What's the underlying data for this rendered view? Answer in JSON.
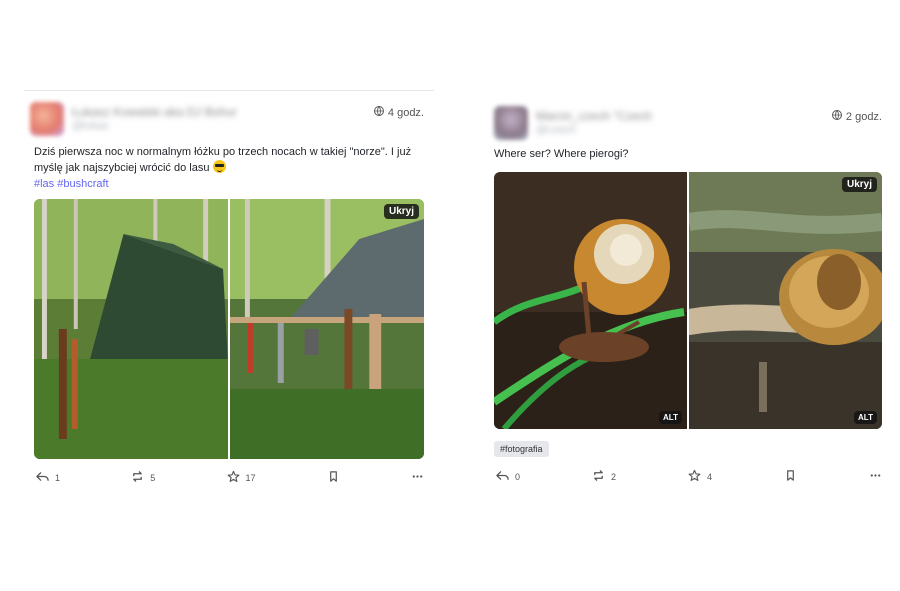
{
  "posts": [
    {
      "author_display": "Łukasz Kowalski aka DJ Bohur",
      "author_handle": "@lukas",
      "visibility_icon": "globe-icon",
      "time": "4 godz.",
      "text": "Dziś pierwsza noc w normalnym łóżku po trzech nocach w takiej \"norze\". I już myślę jak najszybciej wrócić do lasu",
      "emoji_icon": "sunglasses-emoji",
      "hashtags": "#las #bushcraft",
      "hide_label": "Ukryj",
      "actions": {
        "reply": "1",
        "boost": "5",
        "favourite": "17"
      }
    },
    {
      "author_display": "Marcin_czech \"Czech",
      "author_handle": "@czech",
      "visibility_icon": "globe-icon",
      "time": "2 godz.",
      "text": "Where ser? Where pierogi?",
      "hide_label": "Ukryj",
      "alt_labels": [
        "ALT",
        "ALT"
      ],
      "tag_chip": "#fotografia",
      "actions": {
        "reply": "0",
        "boost": "2",
        "favourite": "4"
      }
    }
  ]
}
